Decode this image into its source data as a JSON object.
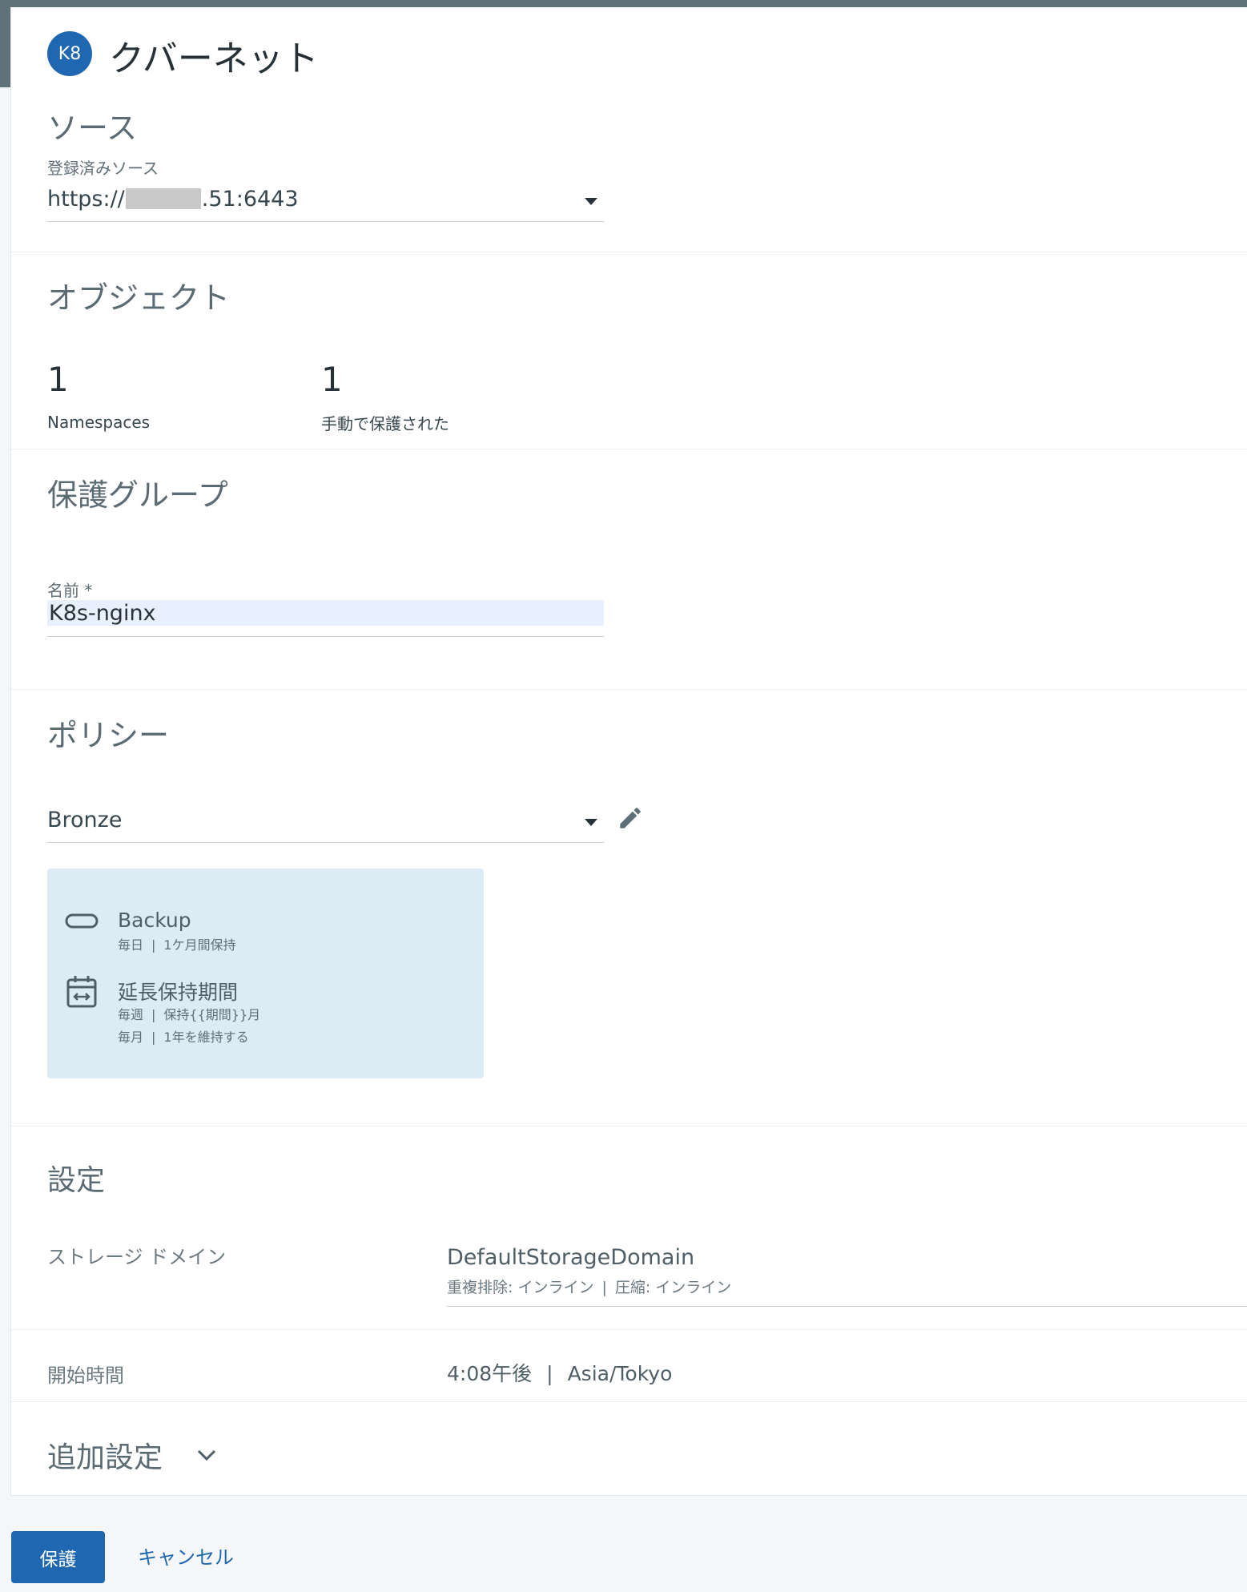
{
  "header": {
    "badge": "K8",
    "title": "クバーネット"
  },
  "source": {
    "title": "ソース",
    "registered_label": "登録済みソース",
    "value_prefix": "https://",
    "value_suffix": ".51:6443"
  },
  "objects": {
    "title": "オブジェクト",
    "namespaces_count": "1",
    "namespaces_label": "Namespaces",
    "manual_count": "1",
    "manual_label": "手動で保護された"
  },
  "protection_group": {
    "title": "保護グループ",
    "name_label": "名前 *",
    "name_value": "K8s-nginx"
  },
  "policy": {
    "title": "ポリシー",
    "selected": "Bronze",
    "backup_title": "Backup",
    "backup_freq": "毎日",
    "backup_retention": "1ケ月間保持",
    "extended_title": "延長保持期間",
    "weekly_freq": "毎週",
    "weekly_retention": "保持{{期間}}月",
    "monthly_freq": "毎月",
    "monthly_retention": "1年を維持する"
  },
  "settings": {
    "title": "設定",
    "storage_label": "ストレージ ドメイン",
    "storage_value": "DefaultStorageDomain",
    "dedup": "重複排除: インライン",
    "compression": "圧縮: インライン",
    "start_label": "開始時間",
    "start_time": "4:08午後",
    "timezone": "Asia/Tokyo",
    "additional": "追加設定"
  },
  "footer": {
    "protect_label": "保護",
    "cancel_label": "キャンセル"
  },
  "colors": {
    "primary": "#1f67b1",
    "policy_card_bg": "#ddebf5",
    "input_autofill_bg": "#e8f0fe"
  },
  "icons": {
    "backup": "backup-pill-icon",
    "extended": "calendar-arrows-icon",
    "edit": "pencil-icon",
    "dropdown": "caret-down-icon",
    "expand": "chevron-down-icon"
  }
}
